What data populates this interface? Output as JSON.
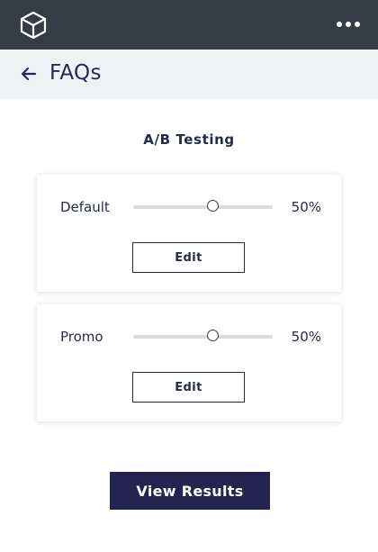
{
  "header": {
    "logo_icon": "cube-icon",
    "menu_icon": "more-horizontal-icon",
    "background": "#343d46"
  },
  "subheader": {
    "back_icon": "arrow-left-icon",
    "title": "FAQs",
    "background": "#edf2f4"
  },
  "main": {
    "section_title": "A/B Testing",
    "variants": [
      {
        "label": "Default",
        "percent_text": "50%",
        "split_percent": 50,
        "edit_label": "Edit"
      },
      {
        "label": "Promo",
        "percent_text": "50%",
        "split_percent": 50,
        "edit_label": "Edit"
      }
    ],
    "view_results_label": "View Results"
  },
  "colors": {
    "brand_dark": "#25234f",
    "text": "#26294f",
    "slider_track": "#dcdcdc"
  }
}
